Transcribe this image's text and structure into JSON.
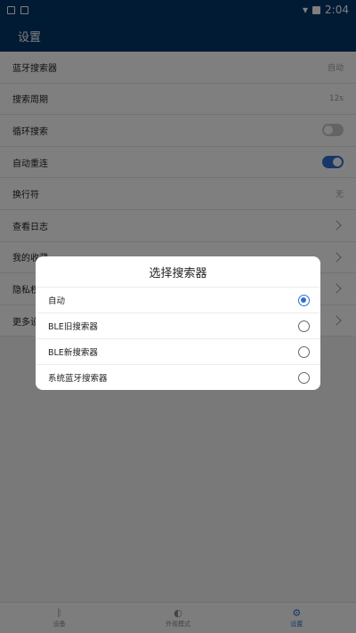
{
  "statusbar": {
    "time": "2:04",
    "icons": [
      "image-icon",
      "a-icon",
      "wifi-icon",
      "battery-icon"
    ]
  },
  "appbar": {
    "title": "设置"
  },
  "settings": {
    "items": [
      {
        "label": "蓝牙搜索器",
        "value": "自动"
      },
      {
        "label": "搜索周期",
        "value": "12s"
      },
      {
        "label": "循环搜索",
        "toggle": "off"
      },
      {
        "label": "自动重连",
        "toggle": "on"
      },
      {
        "label": "换行符",
        "value": "无"
      },
      {
        "label": "查看日志"
      },
      {
        "label": "我的收藏"
      },
      {
        "label": "隐私权政策"
      },
      {
        "label": "更多设置"
      }
    ]
  },
  "bottom_nav": {
    "items": [
      {
        "label": "设备",
        "icon": "bluetooth-icon"
      },
      {
        "label": "外观模式",
        "icon": "palette-icon"
      },
      {
        "label": "设置",
        "icon": "gear-icon",
        "active": true
      }
    ]
  },
  "dialog": {
    "title": "选择搜索器",
    "options": [
      {
        "label": "自动",
        "selected": true
      },
      {
        "label": "BLE旧搜索器",
        "selected": false
      },
      {
        "label": "BLE新搜索器",
        "selected": false
      },
      {
        "label": "系统蓝牙搜索器",
        "selected": false
      }
    ]
  },
  "colors": {
    "primary": "#05376a",
    "accent": "#2f6fd0",
    "scrim": "rgba(0,0,0,0.5)"
  }
}
